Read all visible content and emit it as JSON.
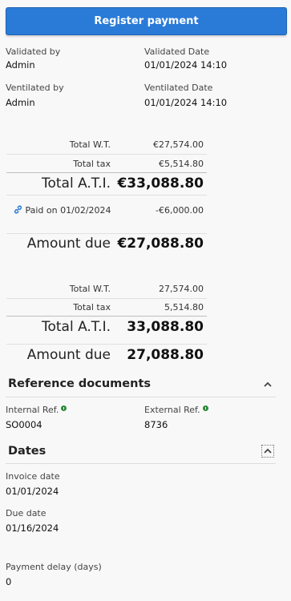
{
  "register_button": "Register payment",
  "audit": {
    "validated_by_label": "Validated by",
    "validated_by_value": "Admin",
    "validated_date_label": "Validated Date",
    "validated_date_value": "01/01/2024 14:10",
    "ventilated_by_label": "Ventilated by",
    "ventilated_by_value": "Admin",
    "ventilated_date_label": "Ventilated Date",
    "ventilated_date_value": "01/01/2024 14:10"
  },
  "totals_currency": {
    "wt_label": "Total W.T.",
    "wt_value": "€27,574.00",
    "tax_label": "Total tax",
    "tax_value": "€5,514.80",
    "ati_label": "Total A.T.I.",
    "ati_value": "€33,088.80",
    "paid_label": "Paid on 01/02/2024",
    "paid_value": "-€6,000.00",
    "due_label": "Amount due",
    "due_value": "€27,088.80"
  },
  "totals_plain": {
    "wt_label": "Total W.T.",
    "wt_value": "27,574.00",
    "tax_label": "Total tax",
    "tax_value": "5,514.80",
    "ati_label": "Total A.T.I.",
    "ati_value": "33,088.80",
    "due_label": "Amount due",
    "due_value": "27,088.80"
  },
  "reference_documents": {
    "title": "Reference documents",
    "internal_ref_label": "Internal Ref.",
    "internal_ref_value": "SO0004",
    "external_ref_label": "External Ref.",
    "external_ref_value": "8736"
  },
  "dates": {
    "title": "Dates",
    "invoice_date_label": "Invoice date",
    "invoice_date_value": "01/01/2024",
    "due_date_label": "Due date",
    "due_date_value": "01/16/2024",
    "payment_delay_label": "Payment delay (days)",
    "payment_delay_value": "0"
  },
  "colors": {
    "primary": "#2a7bd8",
    "link": "#2a7bd8",
    "info": "#2e8b3a"
  },
  "icons": {
    "paid": "link-icon",
    "collapse_reference": "chevron-up-icon",
    "collapse_dates": "chevron-up-icon",
    "info": "info-icon"
  }
}
